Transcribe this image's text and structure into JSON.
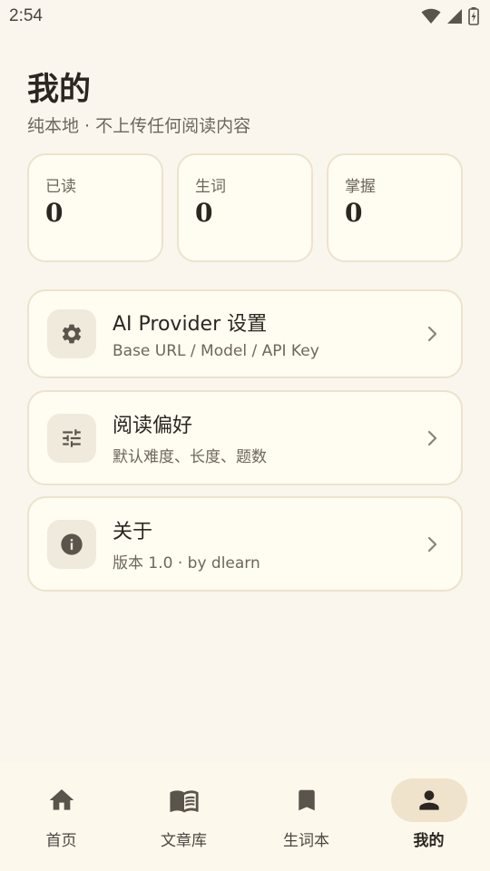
{
  "status_bar": {
    "time": "2:54"
  },
  "header": {
    "title": "我的",
    "subtitle": "纯本地 · 不上传任何阅读内容"
  },
  "stats": [
    {
      "label": "已读",
      "value": "0"
    },
    {
      "label": "生词",
      "value": "0"
    },
    {
      "label": "掌握",
      "value": "0"
    }
  ],
  "settings": [
    {
      "icon": "gear-icon",
      "title": "AI Provider 设置",
      "desc": "Base URL / Model / API Key"
    },
    {
      "icon": "sliders-icon",
      "title": "阅读偏好",
      "desc": "默认难度、长度、题数"
    },
    {
      "icon": "info-icon",
      "title": "关于",
      "desc": "版本 1.0 · by dlearn"
    }
  ],
  "bottom_nav": [
    {
      "icon": "home-icon",
      "label": "首页",
      "active": false
    },
    {
      "icon": "book-icon",
      "label": "文章库",
      "active": false
    },
    {
      "icon": "bookmark-icon",
      "label": "生词本",
      "active": false
    },
    {
      "icon": "person-icon",
      "label": "我的",
      "active": true
    }
  ],
  "colors": {
    "background": "#faf6ee",
    "card": "#fffcf1",
    "card_border": "#ece3cc",
    "icon_bg": "#f0eadc",
    "active_pill": "#efe3cb",
    "icon": "#5a544c"
  }
}
